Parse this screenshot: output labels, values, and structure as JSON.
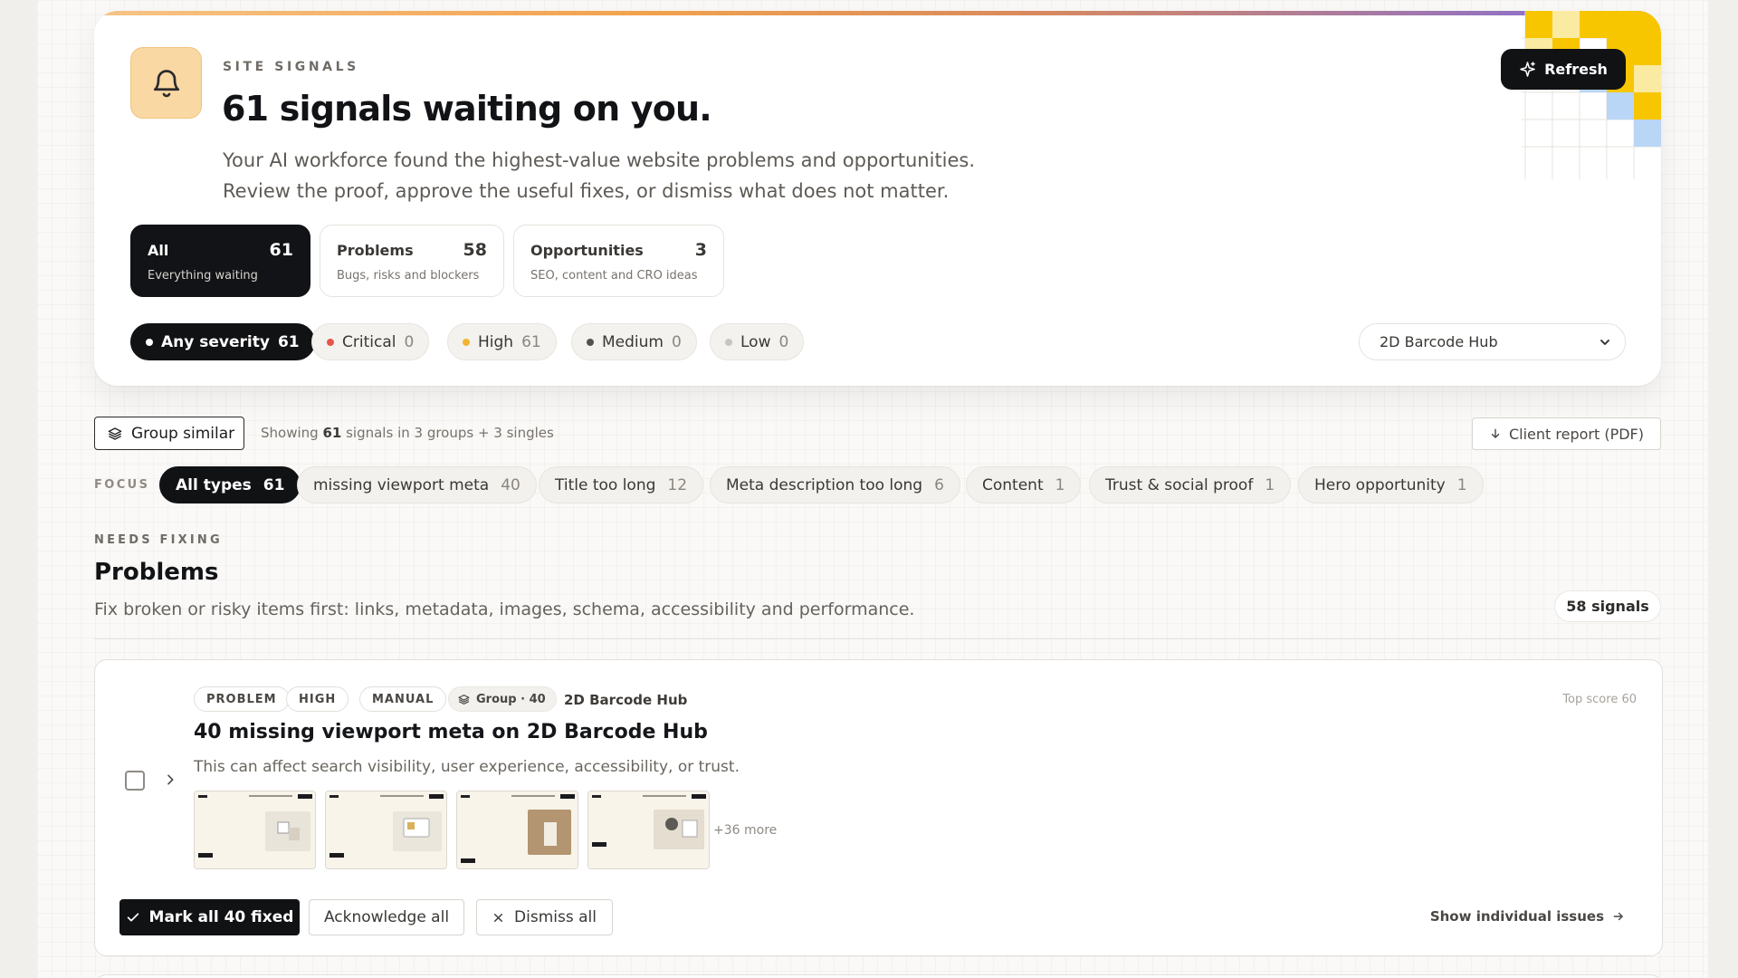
{
  "hero": {
    "kicker": "SITE SIGNALS",
    "title": "61 signals waiting on you.",
    "description_line1": "Your AI workforce found the highest-value website problems and opportunities.",
    "description_line2": "Review the proof, approve the useful fixes, or dismiss what does not matter.",
    "refresh_label": "Refresh",
    "icon": "bell-icon"
  },
  "type_tabs": [
    {
      "title": "All",
      "count": "61",
      "subtitle": "Everything waiting",
      "active": true
    },
    {
      "title": "Problems",
      "count": "58",
      "subtitle": "Bugs, risks and blockers",
      "active": false
    },
    {
      "title": "Opportunities",
      "count": "3",
      "subtitle": "SEO, content and CRO ideas",
      "active": false
    }
  ],
  "severity_filters": [
    {
      "label": "Any severity",
      "count": "61",
      "color": "#ffffff",
      "active": true
    },
    {
      "label": "Critical",
      "count": "0",
      "color": "#e5564a",
      "active": false
    },
    {
      "label": "High",
      "count": "61",
      "color": "#f3b431",
      "active": false
    },
    {
      "label": "Medium",
      "count": "0",
      "color": "#55524e",
      "active": false
    },
    {
      "label": "Low",
      "count": "0",
      "color": "#c9c5c0",
      "active": false
    }
  ],
  "site_select": {
    "value": "2D Barcode Hub"
  },
  "toolbar": {
    "group_label": "Group similar",
    "showing_prefix": "Showing",
    "showing_count": "61",
    "showing_suffix": "signals in 3 groups + 3 singles",
    "report_label": "Client report (PDF)"
  },
  "focus": {
    "label": "FOCUS",
    "chips": [
      {
        "label": "All types",
        "count": "61",
        "active": true
      },
      {
        "label": "missing viewport meta",
        "count": "40",
        "active": false
      },
      {
        "label": "Title too long",
        "count": "12",
        "active": false
      },
      {
        "label": "Meta description too long",
        "count": "6",
        "active": false
      },
      {
        "label": "Content",
        "count": "1",
        "active": false
      },
      {
        "label": "Trust & social proof",
        "count": "1",
        "active": false
      },
      {
        "label": "Hero opportunity",
        "count": "1",
        "active": false
      }
    ]
  },
  "section": {
    "kicker": "NEEDS FIXING",
    "title": "Problems",
    "description": "Fix broken or risky items first: links, metadata, images, schema, accessibility and performance.",
    "badge": "58 signals"
  },
  "issue": {
    "tags": [
      "PROBLEM",
      "HIGH",
      "MANUAL"
    ],
    "group_tag": "Group · 40",
    "site": "2D Barcode Hub",
    "top_score": "Top score 60",
    "title": "40 missing viewport meta on 2D Barcode Hub",
    "description": "This can affect search visibility, user experience, accessibility, or trust.",
    "thumbnails": [
      "Brand-themed product QR codes with packaging and identity",
      "Scan analytics for QR Digital Link QR codes on products",
      "Modern connected actions for offers, events and feedback",
      "Print-ready QR codes for product packaging artwork"
    ],
    "more_label": "+36 more",
    "mark_fixed_label": "Mark all 40 fixed",
    "acknowledge_label": "Acknowledge all",
    "dismiss_label": "Dismiss all",
    "show_individual_label": "Show individual issues"
  },
  "colors": {
    "accent_dark": "#111214",
    "bell_bg": "#fad8a3",
    "deco_yellow": "#f7c600",
    "deco_blue": "#b9d6f6"
  }
}
